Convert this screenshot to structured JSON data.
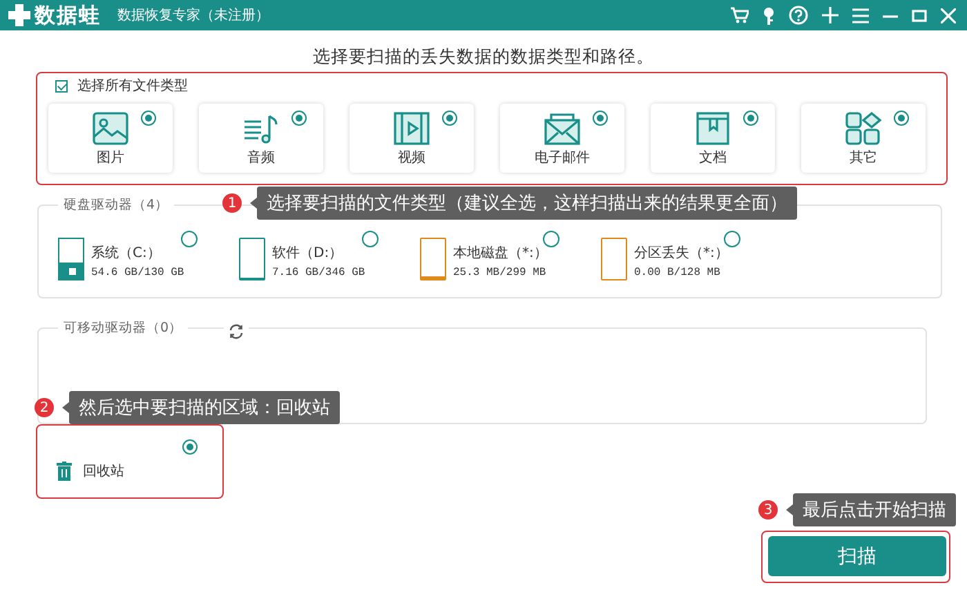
{
  "window": {
    "app_name": "数据蛙",
    "subtitle": "数据恢复专家（未注册）"
  },
  "heading": "选择要扫描的丢失数据的数据类型和路径。",
  "file_types": {
    "select_all": {
      "label": "选择所有文件类型",
      "checked": true
    },
    "items": [
      {
        "label": "图片",
        "kind": "image",
        "selected": true
      },
      {
        "label": "音频",
        "kind": "audio",
        "selected": true
      },
      {
        "label": "视频",
        "kind": "video",
        "selected": true
      },
      {
        "label": "电子邮件",
        "kind": "email",
        "selected": true
      },
      {
        "label": "文档",
        "kind": "document",
        "selected": true
      },
      {
        "label": "其它",
        "kind": "other",
        "selected": true
      }
    ]
  },
  "hard_drives": {
    "title": "硬盘驱动器（4）",
    "drives": [
      {
        "name": "系统（C:）",
        "size": "54.6 GB/130 GB",
        "kind": "system",
        "level": 0.42,
        "color": "#1a8f8a",
        "selected": false
      },
      {
        "name": "软件（D:）",
        "size": "7.16 GB/346 GB",
        "kind": "disk",
        "level": 0.02,
        "color": "#1a8f8a",
        "selected": false
      },
      {
        "name": "本地磁盘（*:）",
        "size": "25.3 MB/299 MB",
        "kind": "disk",
        "level": 0.08,
        "color": "#e08a1e",
        "selected": false
      },
      {
        "name": "分区丢失（*:）",
        "size": "0.00  B/128 MB",
        "kind": "disk",
        "level": 0,
        "color": "#e08a1e",
        "selected": false
      }
    ]
  },
  "removable": {
    "title": "可移动驱动器（0）"
  },
  "locations": [
    {
      "label": "回收站",
      "selected": true
    }
  ],
  "callouts": [
    {
      "number": "1",
      "text": "选择要扫描的文件类型（建议全选，这样扫描出来的结果更全面）"
    },
    {
      "number": "2",
      "text": "然后选中要扫描的区域：回收站"
    },
    {
      "number": "3",
      "text": "最后点击开始扫描"
    }
  ],
  "scan_button": "扫描"
}
